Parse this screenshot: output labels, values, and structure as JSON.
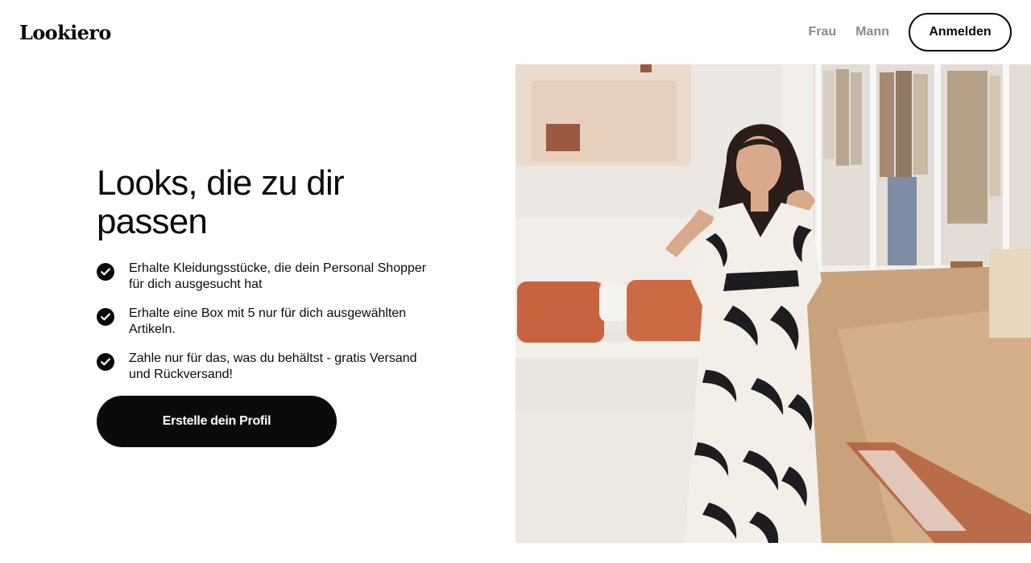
{
  "header": {
    "logo": "Lookiero",
    "nav": [
      {
        "label": "Frau"
      },
      {
        "label": "Mann"
      }
    ],
    "login_label": "Anmelden"
  },
  "hero": {
    "headline": "Looks, die zu dir passen",
    "benefits": [
      "Erhalte Kleidungsstücke, die dein Personal Shopper für dich ausgesucht hat",
      "Erhalte eine Box mit 5 nur für dich ausgewählten Artikeln.",
      "Zahle nur für das, was du behältst - gratis Versand und Rückversand!"
    ],
    "cta_label": "Erstelle dein Profil"
  },
  "colors": {
    "primary": "#0b0b0b",
    "nav_inactive": "#8a8a8a",
    "background": "#ffffff",
    "pillow_accent": "#c7643f",
    "floor": "#c8a27a"
  },
  "icons": {
    "benefit_icon": "check-circle-icon"
  }
}
